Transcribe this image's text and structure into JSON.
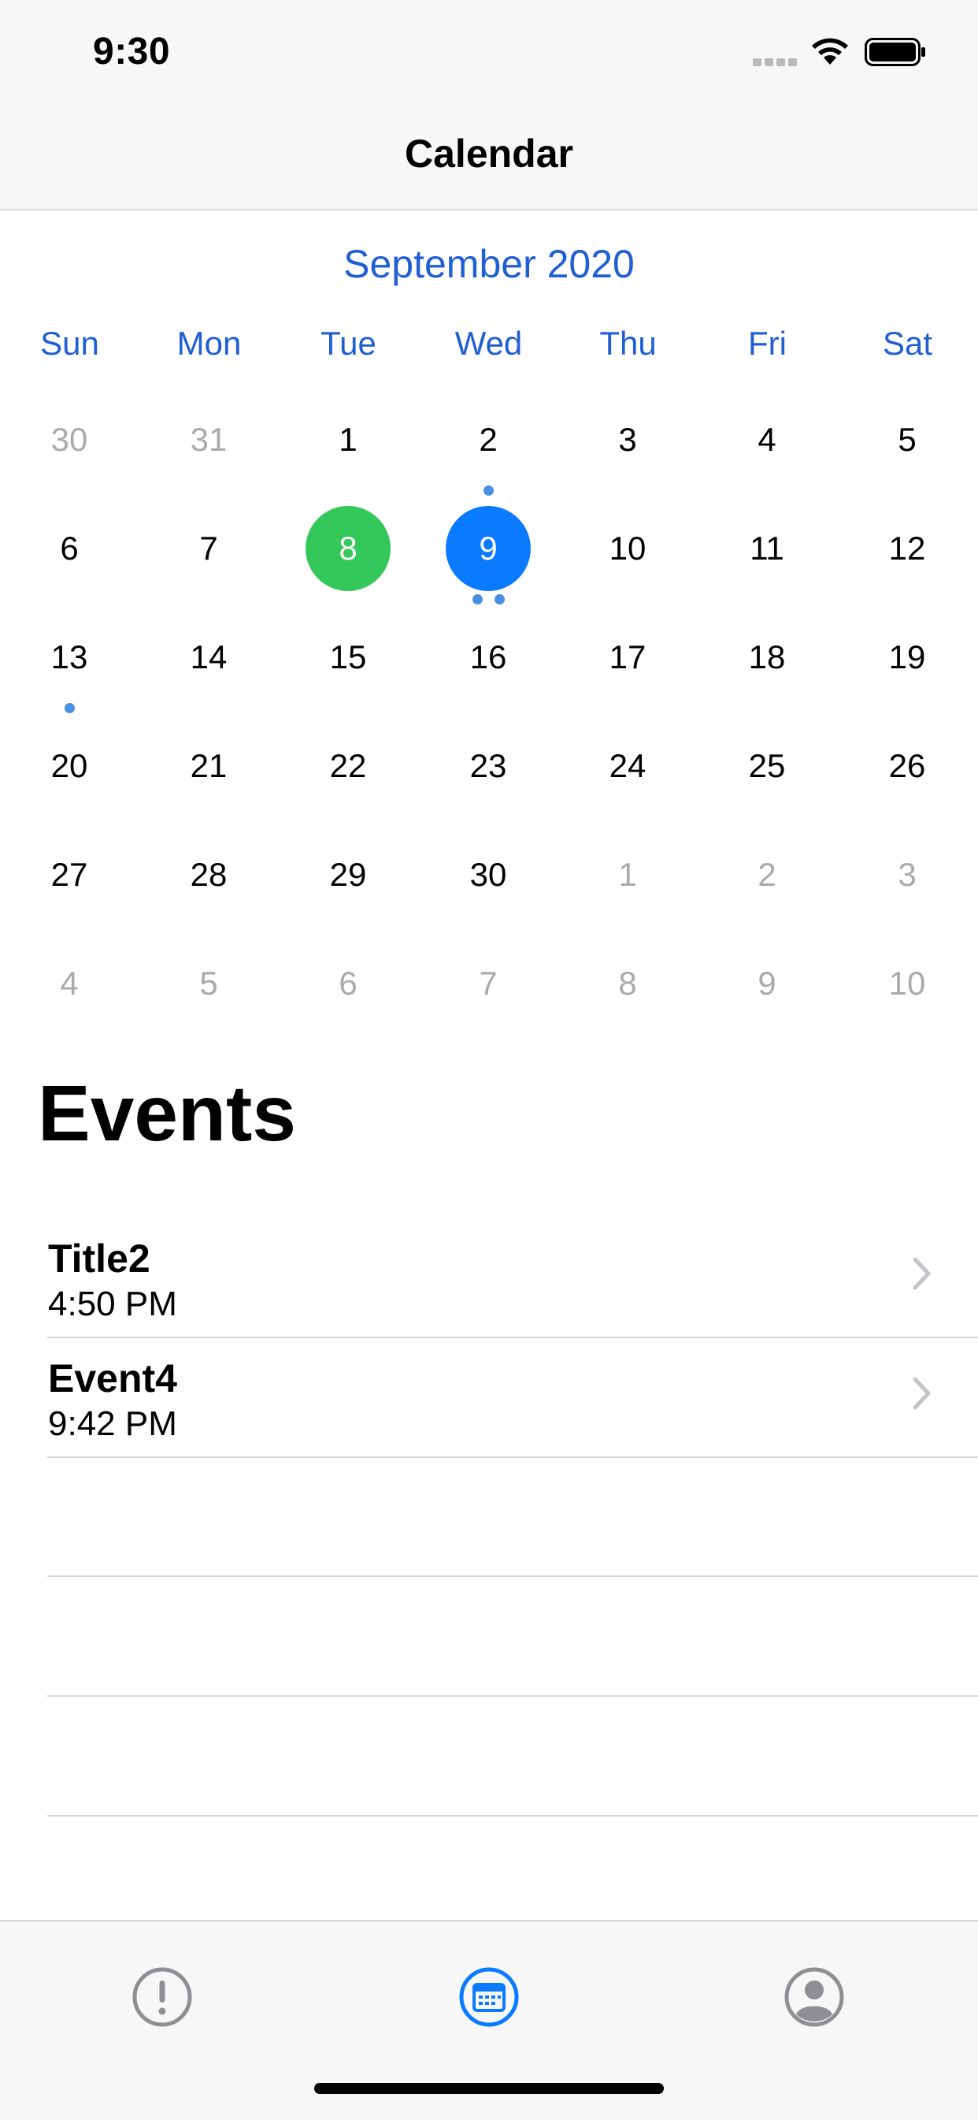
{
  "status_bar": {
    "time": "9:30"
  },
  "nav": {
    "title": "Calendar"
  },
  "calendar": {
    "month_label": "September 2020",
    "weekdays": [
      "Sun",
      "Mon",
      "Tue",
      "Wed",
      "Thu",
      "Fri",
      "Sat"
    ],
    "weeks": [
      [
        {
          "d": "30",
          "m": true
        },
        {
          "d": "31",
          "m": true
        },
        {
          "d": "1"
        },
        {
          "d": "2"
        },
        {
          "d": "3"
        },
        {
          "d": "4"
        },
        {
          "d": "5"
        }
      ],
      [
        {
          "d": "6"
        },
        {
          "d": "7"
        },
        {
          "d": "8",
          "state": "selected"
        },
        {
          "d": "9",
          "state": "today"
        },
        {
          "d": "10"
        },
        {
          "d": "11"
        },
        {
          "d": "12"
        }
      ],
      [
        {
          "d": "13"
        },
        {
          "d": "14"
        },
        {
          "d": "15"
        },
        {
          "d": "16"
        },
        {
          "d": "17"
        },
        {
          "d": "18"
        },
        {
          "d": "19"
        }
      ],
      [
        {
          "d": "20"
        },
        {
          "d": "21"
        },
        {
          "d": "22"
        },
        {
          "d": "23"
        },
        {
          "d": "24"
        },
        {
          "d": "25"
        },
        {
          "d": "26"
        }
      ],
      [
        {
          "d": "27"
        },
        {
          "d": "28"
        },
        {
          "d": "29"
        },
        {
          "d": "30"
        },
        {
          "d": "1",
          "m": true
        },
        {
          "d": "2",
          "m": true
        },
        {
          "d": "3",
          "m": true
        }
      ],
      [
        {
          "d": "4",
          "m": true
        },
        {
          "d": "5",
          "m": true
        },
        {
          "d": "6",
          "m": true
        },
        {
          "d": "7",
          "m": true
        },
        {
          "d": "8",
          "m": true
        },
        {
          "d": "9",
          "m": true
        },
        {
          "d": "10",
          "m": true
        }
      ]
    ],
    "event_dots": [
      {
        "day": "2",
        "count": 1
      },
      {
        "day": "9",
        "count": 2
      },
      {
        "day": "13",
        "count": 1
      }
    ],
    "colors": {
      "accent": "#1f5fd3",
      "selected": "#34c759",
      "today": "#0a7aff",
      "dot": "#4a90e2"
    }
  },
  "events": {
    "title": "Events",
    "items": [
      {
        "title": "Title2",
        "time": "4:50 PM"
      },
      {
        "title": "Event4",
        "time": "9:42 PM"
      }
    ]
  },
  "tabbar": {
    "items": [
      {
        "icon": "exclamation-circle-icon",
        "selected": false
      },
      {
        "icon": "calendar-icon",
        "selected": true
      },
      {
        "icon": "person-circle-icon",
        "selected": false
      }
    ]
  }
}
